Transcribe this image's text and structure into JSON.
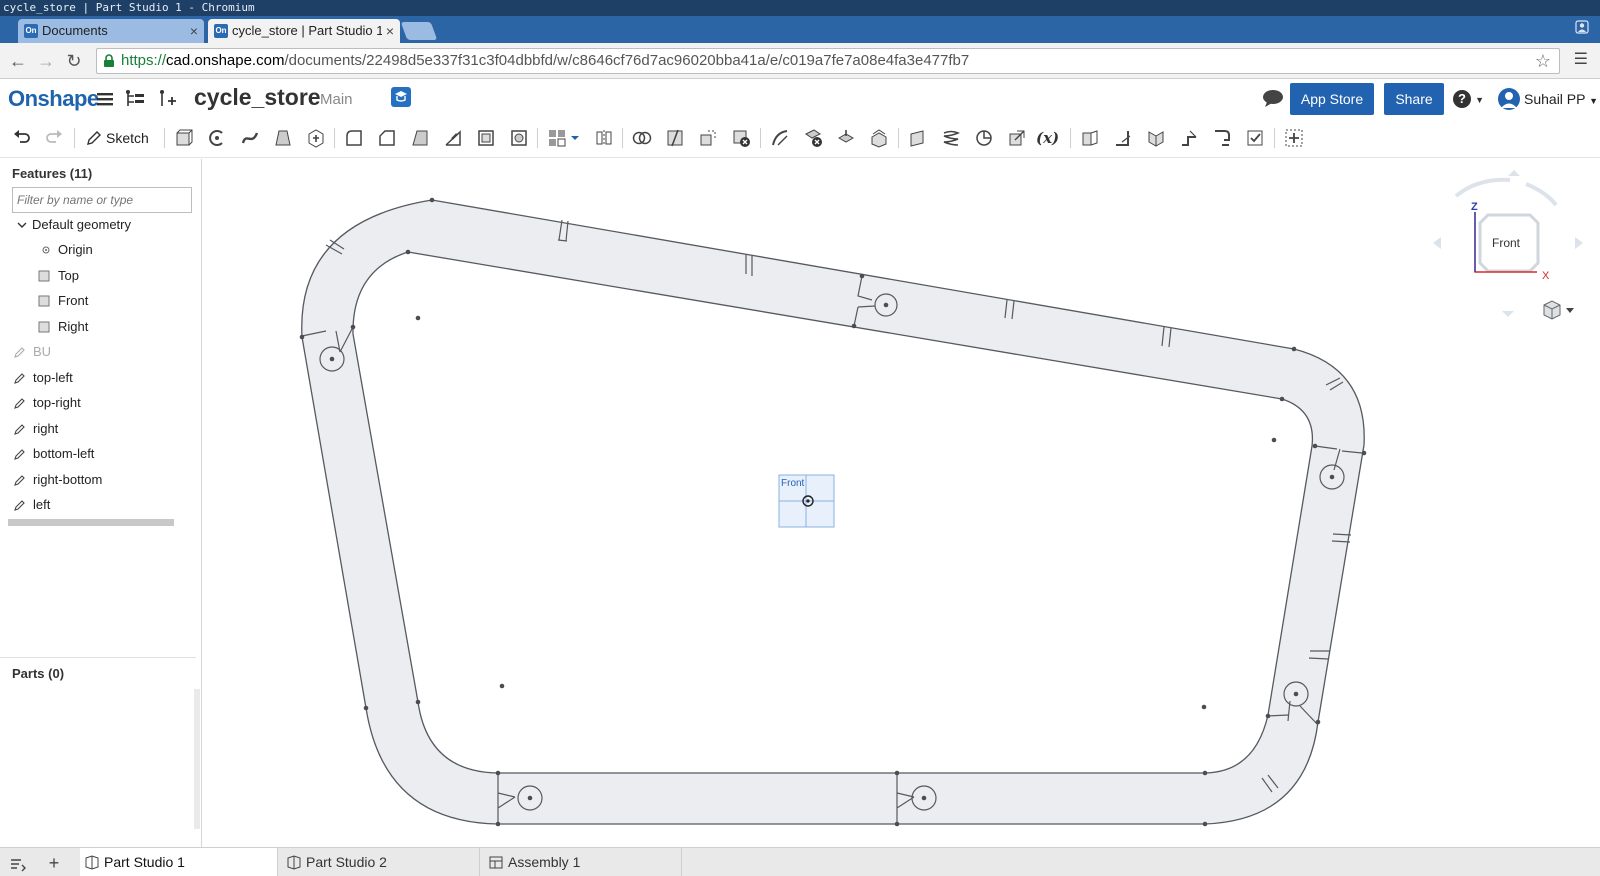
{
  "os_window_title": "cycle_store | Part Studio 1 - Chromium",
  "browser": {
    "tabs": [
      {
        "label": "Documents",
        "favicon": "On"
      },
      {
        "label": "cycle_store | Part Studio 1",
        "favicon": "On"
      }
    ],
    "url": {
      "scheme": "https://",
      "host": "cad.onshape.com",
      "path": "/documents/22498d5e337f31c3f04dbbfd/w/c8646cf76d7ac96020bba41a/e/c019a7fe7a08e4fa3e477fb7"
    }
  },
  "app": {
    "logo": "Onshape",
    "document_title": "cycle_store",
    "branch": "Main",
    "app_store_label": "App Store",
    "share_label": "Share",
    "user_name": "Suhail PP",
    "help_glyph": "?"
  },
  "toolbar": {
    "sketch_label": "Sketch",
    "variable_label": "(x)"
  },
  "features_panel": {
    "title": "Features (11)",
    "filter_placeholder": "Filter by name or type",
    "items": [
      {
        "label": "Default geometry"
      },
      {
        "label": "Origin"
      },
      {
        "label": "Top"
      },
      {
        "label": "Front"
      },
      {
        "label": "Right"
      },
      {
        "label": "BU"
      },
      {
        "label": "top-left"
      },
      {
        "label": "top-right"
      },
      {
        "label": "right"
      },
      {
        "label": "bottom-left"
      },
      {
        "label": "right-bottom"
      },
      {
        "label": "left"
      }
    ],
    "parts_title": "Parts (0)"
  },
  "viewport": {
    "plane_label": "Front",
    "view_cube": {
      "face": "Front",
      "axis_z": "Z",
      "axis_x": "X"
    }
  },
  "bottom_tabs": [
    {
      "label": "Part Studio 1"
    },
    {
      "label": "Part Studio 2"
    },
    {
      "label": "Assembly 1"
    }
  ],
  "colors": {
    "brand_blue": "#2263b1",
    "tabstrip_blue": "#2c65a6",
    "sketch_fill": "#ebedf0",
    "sketch_stroke": "#555a60",
    "axis_red": "#d52a2a"
  }
}
